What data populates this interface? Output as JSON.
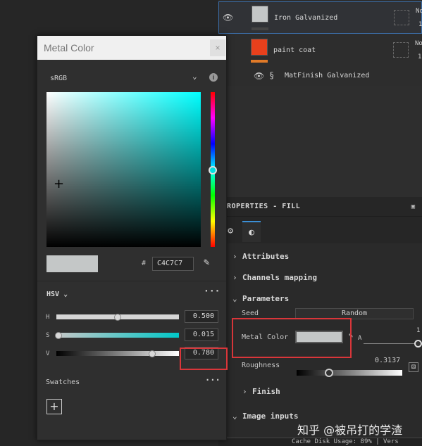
{
  "layers": {
    "items": [
      {
        "name": "Iron Galvanized",
        "thumb_color": "#c4c7c7",
        "bar_color": "#444444",
        "clip_top": "No",
        "clip_bottom": "1"
      },
      {
        "name": "paint coat",
        "thumb_color": "#e8401c",
        "bar_color": "#e07a28",
        "clip_top": "No",
        "clip_bottom": "1"
      },
      {
        "name": "MatFinish Galvanized"
      }
    ]
  },
  "properties": {
    "title": "ROPERTIES - FILL",
    "sections": {
      "attributes": "Attributes",
      "channels": "Channels mapping",
      "parameters": "Parameters",
      "finish": "Finish",
      "image_inputs": "Image inputs"
    },
    "seed_label": "Seed",
    "seed_button": "Random",
    "metal_color_label": "Metal Color",
    "metal_color_value": "#c4c7c7",
    "alpha_label": "A",
    "alpha_value": "1",
    "roughness_label": "Roughness",
    "roughness_value": "0.3137"
  },
  "status_bar": {
    "text": "Cache Disk Usage:  89% | Vers"
  },
  "watermark": "知乎 @被吊打的学渣",
  "popup": {
    "title": "Metal Color",
    "close_label": "×",
    "color_space": "sRGB",
    "current_color": "#c4c7c7",
    "hue_color": "#00ffff",
    "hex_hash": "#",
    "hex_value": "C4C7C7",
    "mode_label": "HSV",
    "sliders": [
      {
        "label": "H",
        "value": "0.500",
        "fraction": 0.5
      },
      {
        "label": "S",
        "value": "0.015",
        "fraction": 0.015
      },
      {
        "label": "V",
        "value": "0.780",
        "fraction": 0.78
      }
    ],
    "swatches_label": "Swatches",
    "add_label": "+"
  },
  "icons": {
    "eye": "eye-icon",
    "close": "close-icon",
    "chevron": "chevron-down-icon",
    "info": "info-icon",
    "eyedropper": "eyedropper-icon",
    "more": "more-icon",
    "add": "plus-icon"
  },
  "colors": {
    "highlight": "#d9363a",
    "accent": "#3b8fd6"
  }
}
